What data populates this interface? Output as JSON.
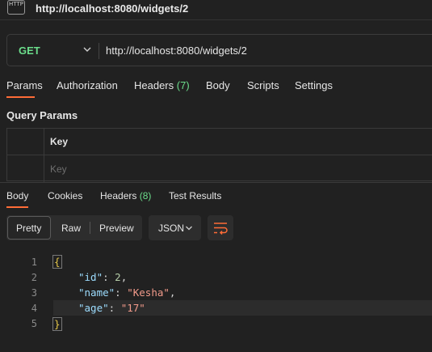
{
  "tab": {
    "icon_text": "HTTP",
    "title": "http://localhost:8080/widgets/2"
  },
  "request": {
    "method": "GET",
    "url": "http://localhost:8080/widgets/2"
  },
  "request_tabs": [
    {
      "label": "Params"
    },
    {
      "label": "Authorization"
    },
    {
      "label": "Headers",
      "count": "(7)"
    },
    {
      "label": "Body"
    },
    {
      "label": "Scripts"
    },
    {
      "label": "Settings"
    }
  ],
  "query_params": {
    "title": "Query Params",
    "header_key": "Key",
    "placeholder_key": "Key"
  },
  "response_tabs": [
    {
      "label": "Body"
    },
    {
      "label": "Cookies"
    },
    {
      "label": "Headers",
      "count": "(8)"
    },
    {
      "label": "Test Results"
    }
  ],
  "format": {
    "pretty": "Pretty",
    "raw": "Raw",
    "preview": "Preview",
    "language": "JSON"
  },
  "code": {
    "line_numbers": [
      "1",
      "2",
      "3",
      "4",
      "5"
    ],
    "open_brace": "{",
    "close_brace": "}",
    "entries": [
      {
        "key": "\"id\"",
        "value": "2",
        "value_type": "number",
        "trailing": ","
      },
      {
        "key": "\"name\"",
        "value": "\"Kesha\"",
        "value_type": "string",
        "trailing": ","
      },
      {
        "key": "\"age\"",
        "value": "\"17\"",
        "value_type": "string",
        "trailing": ""
      }
    ],
    "colon": ":"
  },
  "colors": {
    "accent": "#ff6c37",
    "method_get": "#6bdd8b",
    "count_green": "#6bdd8b",
    "background": "#212121"
  },
  "icons": {
    "method_dropdown": "chevron-down-icon",
    "language_dropdown": "chevron-down-icon",
    "wrap": "wrap-lines-icon"
  }
}
